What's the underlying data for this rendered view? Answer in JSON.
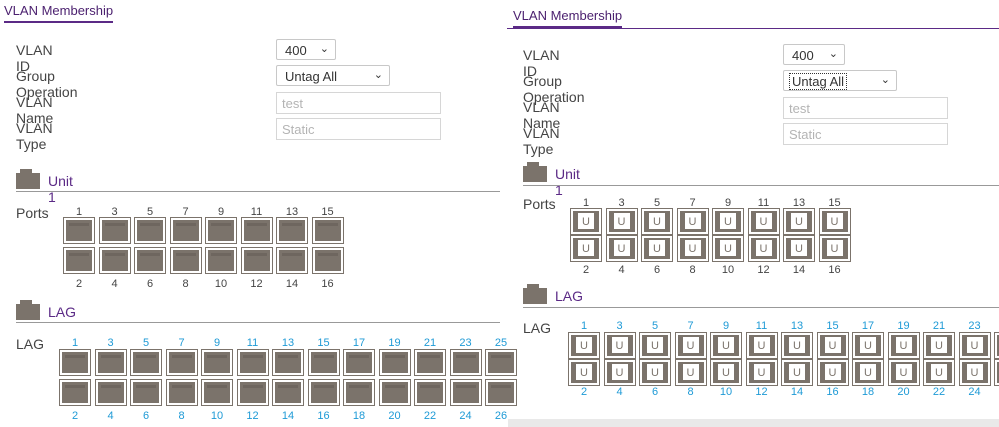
{
  "left": {
    "title": "VLAN Membership",
    "fields": {
      "vlan_id_label": "VLAN ID",
      "vlan_id_value": "400",
      "group_op_label": "Group Operation",
      "group_op_value": "Untag All",
      "vlan_name_label": "VLAN Name",
      "vlan_name_value": "test",
      "vlan_type_label": "VLAN Type",
      "vlan_type_value": "Static"
    },
    "unit_label": "Unit 1",
    "ports_label": "Ports",
    "port_top_numbers": [
      "1",
      "3",
      "5",
      "7",
      "9",
      "11",
      "13",
      "15"
    ],
    "port_bottom_numbers": [
      "2",
      "4",
      "6",
      "8",
      "10",
      "12",
      "14",
      "16"
    ],
    "port_state": "untagged-off",
    "lag_section_label": "LAG",
    "lag_row_label": "LAG",
    "lag_top_numbers": [
      "1",
      "3",
      "5",
      "7",
      "9",
      "11",
      "13",
      "15",
      "17",
      "19",
      "21",
      "23",
      "25"
    ],
    "lag_bottom_numbers": [
      "2",
      "4",
      "6",
      "8",
      "10",
      "12",
      "14",
      "16",
      "18",
      "20",
      "22",
      "24",
      "26"
    ]
  },
  "right": {
    "title": "VLAN Membership",
    "fields": {
      "vlan_id_label": "VLAN ID",
      "vlan_id_value": "400",
      "group_op_label": "Group Operation",
      "group_op_value": "Untag All",
      "vlan_name_label": "VLAN Name",
      "vlan_name_value": "test",
      "vlan_type_label": "VLAN Type",
      "vlan_type_value": "Static"
    },
    "unit_label": "Unit 1",
    "ports_label": "Ports",
    "port_top_numbers": [
      "1",
      "3",
      "5",
      "7",
      "9",
      "11",
      "13",
      "15"
    ],
    "port_bottom_numbers": [
      "2",
      "4",
      "6",
      "8",
      "10",
      "12",
      "14",
      "16"
    ],
    "port_marker": "U",
    "lag_section_label": "LAG",
    "lag_row_label": "LAG",
    "lag_top_numbers": [
      "1",
      "3",
      "5",
      "7",
      "9",
      "11",
      "13",
      "15",
      "17",
      "19",
      "21",
      "23",
      "2"
    ],
    "lag_bottom_numbers": [
      "2",
      "4",
      "6",
      "8",
      "10",
      "12",
      "14",
      "16",
      "18",
      "20",
      "22",
      "24",
      "2"
    ]
  },
  "colors": {
    "accent": "#5b2a86",
    "port_gray": "#7b736b",
    "lag_number_blue": "#1e9ad6"
  },
  "icons": {
    "section_icon": "folder-icon",
    "dropdown": "chevron-down-icon"
  }
}
